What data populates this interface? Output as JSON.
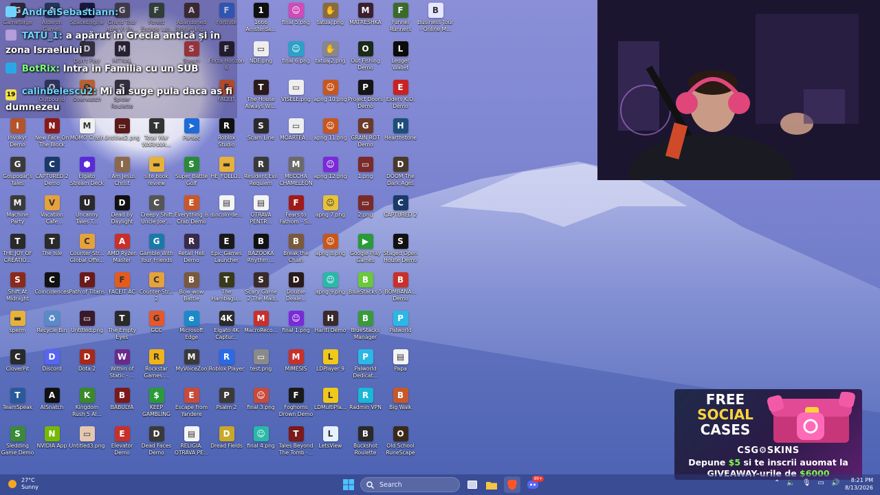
{
  "desktop": {
    "icons": [
      {
        "label": "Gameforge",
        "color": "#2a2a2a",
        "glyph": "G"
      },
      {
        "label": "Alderon Games",
        "color": "#1d3b5a",
        "glyph": "A"
      },
      {
        "label": "SpaceEngine",
        "color": "#0b1430",
        "glyph": "✦"
      },
      {
        "label": "Grand Tour Auto VI En...",
        "color": "#444",
        "glyph": "G"
      },
      {
        "label": "Forest Escape Last Train D...",
        "color": "#2f4a2a",
        "glyph": "F"
      },
      {
        "label": "Abandoned Stories Ing...",
        "color": "#3d2a22",
        "glyph": "A"
      },
      {
        "label": "Fortnite",
        "color": "#2d6ad8",
        "glyph": "F"
      },
      {
        "label": "1666 Amsterda...",
        "color": "#101010",
        "glyph": "1"
      },
      {
        "label": "final 5.png",
        "color": "#d04ab8",
        "glyph": "☺"
      },
      {
        "label": "tatuaj.png",
        "color": "#8a6b3a",
        "glyph": "✋"
      },
      {
        "label": "MATRESHKA",
        "color": "#3a2030",
        "glyph": "M"
      },
      {
        "label": "Funnel Runners",
        "color": "#3a6b2a",
        "glyph": "F"
      },
      {
        "label": "Business Tour - Online M...",
        "color": "#e6e6ff",
        "glyph": "B"
      },
      {
        "label": "Don't Play",
        "color": "#333",
        "glyph": "D"
      },
      {
        "label": "MITNAL",
        "color": "#222",
        "glyph": "M"
      },
      {
        "label": "Steam",
        "color": "#c0392b",
        "glyph": "S"
      },
      {
        "label": "Forza Horizon 6",
        "color": "#1a1a1a",
        "glyph": "F"
      },
      {
        "label": "NDE.png",
        "color": "#eeeeee",
        "glyph": "▭"
      },
      {
        "label": "final 6.png",
        "color": "#2aa2c8",
        "glyph": "☺"
      },
      {
        "label": "tatuaj2.png",
        "color": "#888",
        "glyph": "✋"
      },
      {
        "label": "Out Fishing Demo",
        "color": "#1c2a18",
        "glyph": "O"
      },
      {
        "label": "Ledger Wallet",
        "color": "#0b0b0b",
        "glyph": "L"
      },
      {
        "label": "Outbound",
        "color": "#2a3a5a",
        "glyph": "O"
      },
      {
        "label": "Overwatch",
        "color": "#ee7b22",
        "glyph": "O"
      },
      {
        "label": "Spider Roulette",
        "color": "#333",
        "glyph": "S"
      },
      {
        "label": "FACEIT",
        "color": "#e55b1b",
        "glyph": "F"
      },
      {
        "label": "The House Always Wi...",
        "color": "#2a1a1a",
        "glyph": "T"
      },
      {
        "label": "VISELE.png",
        "color": "#eeeeee",
        "glyph": "▭"
      },
      {
        "label": "apng 10.png",
        "color": "#c8571c",
        "glyph": "☺"
      },
      {
        "label": "Project Doors Demo",
        "color": "#151515",
        "glyph": "P"
      },
      {
        "label": "Elders K.O. Demo",
        "color": "#c92222",
        "glyph": "E"
      },
      {
        "label": "Invokyr Demo",
        "color": "#b4542a",
        "glyph": "I"
      },
      {
        "label": "New Face On The Block",
        "color": "#8a1a1a",
        "glyph": "N"
      },
      {
        "label": "MOMO Crash",
        "color": "#f0f0f0",
        "glyph": "M"
      },
      {
        "label": "Untitled2.png",
        "color": "#5a1a1a",
        "glyph": "▭"
      },
      {
        "label": "Total War WARHAM...",
        "color": "#333",
        "glyph": "T"
      },
      {
        "label": "Parsec",
        "color": "#1e6bd6",
        "glyph": "➤"
      },
      {
        "label": "Roblox Studio",
        "color": "#101010",
        "glyph": "R"
      },
      {
        "label": "Scam Line",
        "color": "#2a2a2a",
        "glyph": "S"
      },
      {
        "label": "MOARTEA....",
        "color": "#eeeeee",
        "glyph": "▭"
      },
      {
        "label": "apng 11.png",
        "color": "#c8571c",
        "glyph": "☺"
      },
      {
        "label": "GRAIN ROT Demo",
        "color": "#6a3a2a",
        "glyph": "G"
      },
      {
        "label": "Hearthstone",
        "color": "#1e4e7a",
        "glyph": "H"
      },
      {
        "label": "Gospodar's Tales",
        "color": "#3a3a3a",
        "glyph": "G"
      },
      {
        "label": "CAPTURED 2 Demo",
        "color": "#1a3a6a",
        "glyph": "C"
      },
      {
        "label": "Elgato Stream Deck",
        "color": "#5a2ad8",
        "glyph": "⬢"
      },
      {
        "label": "I Am Jesus Christ",
        "color": "#8a6a4a",
        "glyph": "I"
      },
      {
        "label": "site book review",
        "color": "#e6b23a",
        "glyph": "▬"
      },
      {
        "label": "Super Battle Golf",
        "color": "#2a8a3a",
        "glyph": "S"
      },
      {
        "label": "HE_FOLLO...",
        "color": "#e6b23a",
        "glyph": "▬"
      },
      {
        "label": "Resident Evil Requiem",
        "color": "#3a3a3a",
        "glyph": "R"
      },
      {
        "label": "MECCHA CHAMELEON",
        "color": "#6a6a6a",
        "glyph": "M"
      },
      {
        "label": "apng 12.png",
        "color": "#7a2ad8",
        "glyph": "☺"
      },
      {
        "label": "1.png",
        "color": "#7a2a2a",
        "glyph": "▭"
      },
      {
        "label": "DOOM The Dark Ages",
        "color": "#4a3a2a",
        "glyph": "D"
      },
      {
        "label": "Machine Party",
        "color": "#3a3a3a",
        "glyph": "M"
      },
      {
        "label": "Vacation Cafe Simulator D...",
        "color": "#e6a23a",
        "glyph": "V"
      },
      {
        "label": "Uncanny Tales T...",
        "color": "#2a2a2a",
        "glyph": "U"
      },
      {
        "label": "Dead by Daylight",
        "color": "#111",
        "glyph": "D"
      },
      {
        "label": "Creepy Shift Uncle Joe'...",
        "color": "#555",
        "glyph": "C"
      },
      {
        "label": "Everything is Crab Demo",
        "color": "#c8582a",
        "glyph": "E"
      },
      {
        "label": "dincolo-de...",
        "color": "#f4f4f4",
        "glyph": "▤"
      },
      {
        "label": "OTRAVA PENTR...",
        "color": "#f4f4f4",
        "glyph": "▤"
      },
      {
        "label": "Fears to Fathom - S...",
        "color": "#a01a1a",
        "glyph": "F"
      },
      {
        "label": "apng 7.png",
        "color": "#e6c23a",
        "glyph": "☺"
      },
      {
        "label": "2.png",
        "color": "#7a2a2a",
        "glyph": "▭"
      },
      {
        "label": "CAPTURED 2",
        "color": "#1a3a6a",
        "glyph": "C"
      },
      {
        "label": "THE JOY OF CREATIO...",
        "color": "#2a2a2a",
        "glyph": "T"
      },
      {
        "label": "The Isle",
        "color": "#2a2a2a",
        "glyph": "T"
      },
      {
        "label": "Counter-Str... Global Offe...",
        "color": "#e6a23a",
        "glyph": "C"
      },
      {
        "label": "AMD Ryzen Master",
        "color": "#c8302a",
        "glyph": "A"
      },
      {
        "label": "Gamble With Your Friends",
        "color": "#1a7aa8",
        "glyph": "G"
      },
      {
        "label": "Retail Hell Demo",
        "color": "#3a2a4a",
        "glyph": "R"
      },
      {
        "label": "Epic Games Launcher",
        "color": "#1a1a1a",
        "glyph": "E"
      },
      {
        "label": "BAZOOKA Rhythm ...",
        "color": "#111",
        "glyph": "B"
      },
      {
        "label": "Break the Chain",
        "color": "#7a5a3a",
        "glyph": "B"
      },
      {
        "label": "apng 8.png",
        "color": "#c8571c",
        "glyph": "☺"
      },
      {
        "label": "Google Play Games",
        "color": "#2a9a3a",
        "glyph": "▶"
      },
      {
        "label": "Staged Open House Demo",
        "color": "#111",
        "glyph": "S"
      },
      {
        "label": "Shift At Midnight",
        "color": "#8a2a1a",
        "glyph": "S"
      },
      {
        "label": "Coincidences",
        "color": "#111",
        "glyph": "C"
      },
      {
        "label": "Path of Titans",
        "color": "#6a1a1a",
        "glyph": "P"
      },
      {
        "label": "FACEIT AC",
        "color": "#e55b1b",
        "glyph": "F"
      },
      {
        "label": "Counter-Str... 2",
        "color": "#e6a23a",
        "glyph": "C"
      },
      {
        "label": "Bow-wow Battle",
        "color": "#7a5a3a",
        "glyph": "B"
      },
      {
        "label": "The Hambagu...",
        "color": "#3a3a1a",
        "glyph": "T"
      },
      {
        "label": "Scary Game 2 The Mad S...",
        "color": "#3a2a2a",
        "glyph": "S"
      },
      {
        "label": "Double Deale...",
        "color": "#2a1a1a",
        "glyph": "D"
      },
      {
        "label": "apng 9.png",
        "color": "#2ab8a8",
        "glyph": "☺"
      },
      {
        "label": "BlueStacks 5",
        "color": "#6ac83a",
        "glyph": "B"
      },
      {
        "label": "BOMBANA... Demo",
        "color": "#c8302a",
        "glyph": "B"
      },
      {
        "label": "sperm",
        "color": "#e6b23a",
        "glyph": "▬"
      },
      {
        "label": "Recycle Bin",
        "color": "#5a8ac8",
        "glyph": "♻"
      },
      {
        "label": "Untitled.png",
        "color": "#3a1a2a",
        "glyph": "▭"
      },
      {
        "label": "The Empty Eyes",
        "color": "#2a2a2a",
        "glyph": "T"
      },
      {
        "label": "GCC",
        "color": "#e6582a",
        "glyph": "G"
      },
      {
        "label": "Microsoft Edge",
        "color": "#1a8ac8",
        "glyph": "e"
      },
      {
        "label": "Elgato 4K Captur...",
        "color": "#2a2a2a",
        "glyph": "4K"
      },
      {
        "label": "MacroReco...",
        "color": "#c8302a",
        "glyph": "M"
      },
      {
        "label": "final 1.png",
        "color": "#7a2ad8",
        "glyph": "☺"
      },
      {
        "label": "Hariti Demo",
        "color": "#3a2a2a",
        "glyph": "H"
      },
      {
        "label": "BlueStacks Manager",
        "color": "#3a9a3a",
        "glyph": "B"
      },
      {
        "label": "Palworld",
        "color": "#2ab8e6",
        "glyph": "P"
      },
      {
        "label": "CloverPit",
        "color": "#2a2a2a",
        "glyph": "C"
      },
      {
        "label": "Discord",
        "color": "#5865f2",
        "glyph": "D"
      },
      {
        "label": "Dota 2",
        "color": "#a8281a",
        "glyph": "D"
      },
      {
        "label": "Within of Static - ...",
        "color": "#6a2a8a",
        "glyph": "W"
      },
      {
        "label": "Rockstar Games ...",
        "color": "#f0b41a",
        "glyph": "R"
      },
      {
        "label": "MyVoiceZoo",
        "color": "#3a3a3a",
        "glyph": "M"
      },
      {
        "label": "Roblox Player",
        "color": "#2a6ae6",
        "glyph": "R"
      },
      {
        "label": "test.png",
        "color": "#8a8a8a",
        "glyph": "▭"
      },
      {
        "label": "MIMESIS",
        "color": "#c8302a",
        "glyph": "M"
      },
      {
        "label": "LDPlayer 9",
        "color": "#f0c81a",
        "glyph": "L"
      },
      {
        "label": "Palworld Dedicat...",
        "color": "#2ab8e6",
        "glyph": "P"
      },
      {
        "label": "Papa",
        "color": "#f4f4f4",
        "glyph": "▤"
      },
      {
        "label": "TeamSpeak",
        "color": "#2a5a9a",
        "glyph": "T"
      },
      {
        "label": "AISnatch",
        "color": "#111",
        "glyph": "A"
      },
      {
        "label": "Kingdom Rush 5 Al...",
        "color": "#3a8a2a",
        "glyph": "K"
      },
      {
        "label": "BABULYA",
        "color": "#7a1a1a",
        "glyph": "B"
      },
      {
        "label": "KEEP GAMBLING",
        "color": "#2a9a3a",
        "glyph": "$"
      },
      {
        "label": "Escape from Yandere",
        "color": "#c84a3a",
        "glyph": "E"
      },
      {
        "label": "Psalm 2",
        "color": "#3a3a3a",
        "glyph": "P"
      },
      {
        "label": "final 3.png",
        "color": "#c84a3a",
        "glyph": "☺"
      },
      {
        "label": "Foghorns Drown Demo",
        "color": "#1a1a1a",
        "glyph": "F"
      },
      {
        "label": "LDMultiPla...",
        "color": "#f0c81a",
        "glyph": "L"
      },
      {
        "label": "Radmin VPN",
        "color": "#1ab8d8",
        "glyph": "R"
      },
      {
        "label": "Big Walk",
        "color": "#c8582a",
        "glyph": "B"
      },
      {
        "label": "Sledding Game Demo",
        "color": "#3a8a3a",
        "glyph": "S"
      },
      {
        "label": "NVIDIA App",
        "color": "#76b900",
        "glyph": "N"
      },
      {
        "label": "Untitled3.png",
        "color": "#e6c8b0",
        "glyph": "▭"
      },
      {
        "label": "Elevator Demo",
        "color": "#c8302a",
        "glyph": "E"
      },
      {
        "label": "Dead Faces Demo",
        "color": "#3a3a3a",
        "glyph": "D"
      },
      {
        "label": "RELIGIA. OTRAVA PE...",
        "color": "#f4f4f4",
        "glyph": "▤"
      },
      {
        "label": "Dread Fields",
        "color": "#c8a82a",
        "glyph": "D"
      },
      {
        "label": "final 4.png",
        "color": "#2ab8a8",
        "glyph": "☺"
      },
      {
        "label": "Tales Beyond The Tomb -...",
        "color": "#7a1a1a",
        "glyph": "T"
      },
      {
        "label": "LetsView",
        "color": "#e6f0ff",
        "glyph": "L"
      },
      {
        "label": "Buckshot Roulette",
        "color": "#2a2a2a",
        "glyph": "B"
      },
      {
        "label": "Old School RuneScape",
        "color": "#3a2a1a",
        "glyph": "O"
      }
    ]
  },
  "chat": {
    "messages": [
      {
        "user": "AndreiSebastiann:",
        "text": "",
        "badge": "",
        "badge_color": "#6fd3ff"
      },
      {
        "user": "TATU_1:",
        "text": "a apărut în Grecia antică și în zona Israelului",
        "badge": "",
        "badge_color": "#b39ddb"
      },
      {
        "user": "BotRix:",
        "text": "Intra in Familia  cu un SUB",
        "badge": "",
        "badge_color": "#2aa8e6"
      },
      {
        "user": "calinbelescu2:",
        "text": "Mi ai suge pula daca as fi dumnezeu",
        "badge": "19",
        "badge_color": "#f2e34a"
      }
    ]
  },
  "ad": {
    "line1": "FREE",
    "line2": "SOCIAL",
    "line3": "CASES",
    "brand": "CSG",
    "brand_suffix": "SKINS",
    "cta_prefix": "Depune ",
    "cta_amount": "$5",
    "cta_mid": " si te inscrii auomat la",
    "cta_bottom_pre": "GIVEAWAY-urile de ",
    "cta_bottom_amount": "$6000"
  },
  "taskbar": {
    "weather_temp": "27°C",
    "weather_cond": "Sunny",
    "search_placeholder": "Search",
    "time": "8:21 PM",
    "date": "8/13/2026",
    "discord_badge": "99+"
  }
}
